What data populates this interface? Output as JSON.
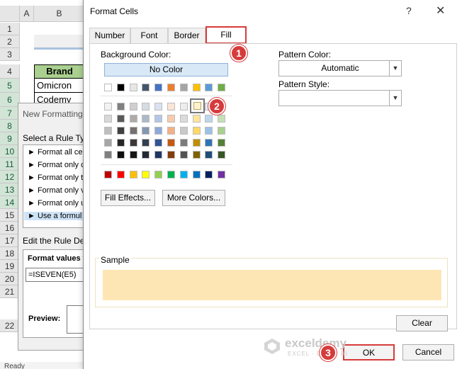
{
  "excel": {
    "columns": [
      "A",
      "B"
    ],
    "rows": [
      "1",
      "2",
      "3",
      "4",
      "5",
      "6",
      "7",
      "8",
      "9",
      "10",
      "11",
      "12",
      "13",
      "14",
      "15",
      "16",
      "17",
      "18",
      "19",
      "20",
      "21",
      "22"
    ],
    "header_cell": "Brand",
    "cells": [
      "Omicron",
      "Codemy"
    ],
    "status_left": "Ready"
  },
  "new_rule": {
    "title": "New Formatting",
    "select_label": "Select a Rule Typ",
    "rule_types": [
      "► Format all ce",
      "► Format only c",
      "► Format only t",
      "► Format only v",
      "► Format only u",
      "► Use a formul"
    ],
    "edit_label": "Edit the Rule Des",
    "format_values_label": "Format values v",
    "formula": "=ISEVEN(E5)",
    "preview_label": "Preview:"
  },
  "format_cells": {
    "title": "Format Cells",
    "help": "?",
    "close": "✕",
    "tabs": [
      "Number",
      "Font",
      "Border",
      "Fill"
    ],
    "active_tab": "Fill",
    "background_color_label": "Background Color:",
    "no_color": "No Color",
    "palette": {
      "theme_top": [
        "#ffffff",
        "#000000",
        "#e7e6e6",
        "#44546a",
        "#4472c4",
        "#ed7d31",
        "#a5a5a5",
        "#ffc000",
        "#5b9bd5",
        "#70ad47"
      ],
      "tints": [
        [
          "#f2f2f2",
          "#808080",
          "#d0cece",
          "#d6dce4",
          "#d9e1f2",
          "#fce4d6",
          "#ededed",
          "#fff2cc",
          "#ddebf7",
          "#e2efda"
        ],
        [
          "#d9d9d9",
          "#595959",
          "#aeaaaa",
          "#acb9ca",
          "#b4c6e7",
          "#f8cbad",
          "#dbdbdb",
          "#ffe699",
          "#bdd7ee",
          "#c6e0b4"
        ],
        [
          "#bfbfbf",
          "#404040",
          "#757171",
          "#8497b0",
          "#8ea9db",
          "#f4b084",
          "#c9c9c9",
          "#ffd966",
          "#9bc2e6",
          "#a9d08e"
        ],
        [
          "#a6a6a6",
          "#262626",
          "#3a3838",
          "#333f4f",
          "#305496",
          "#c65911",
          "#7b7b7b",
          "#bf8f00",
          "#2f75b5",
          "#548235"
        ],
        [
          "#808080",
          "#0d0d0d",
          "#161616",
          "#222b35",
          "#203764",
          "#833c0c",
          "#525252",
          "#806000",
          "#1f4e78",
          "#375623"
        ]
      ],
      "standard": [
        "#c00000",
        "#ff0000",
        "#ffc000",
        "#ffff00",
        "#92d050",
        "#00b050",
        "#00b0f0",
        "#0070c0",
        "#002060",
        "#7030a0"
      ]
    },
    "fill_effects": "Fill Effects...",
    "more_colors": "More Colors...",
    "pattern_color_label": "Pattern Color:",
    "pattern_color_value": "Automatic",
    "pattern_style_label": "Pattern Style:",
    "pattern_style_value": "",
    "sample_label": "Sample",
    "sample_color": "#fee6b4",
    "clear": "Clear",
    "ok": "OK",
    "cancel": "Cancel"
  },
  "markers": [
    "1",
    "2",
    "3"
  ],
  "watermark": {
    "name": "exceldemy",
    "sub": "EXCEL · DATA · BI"
  },
  "accent": "#d63b3b"
}
